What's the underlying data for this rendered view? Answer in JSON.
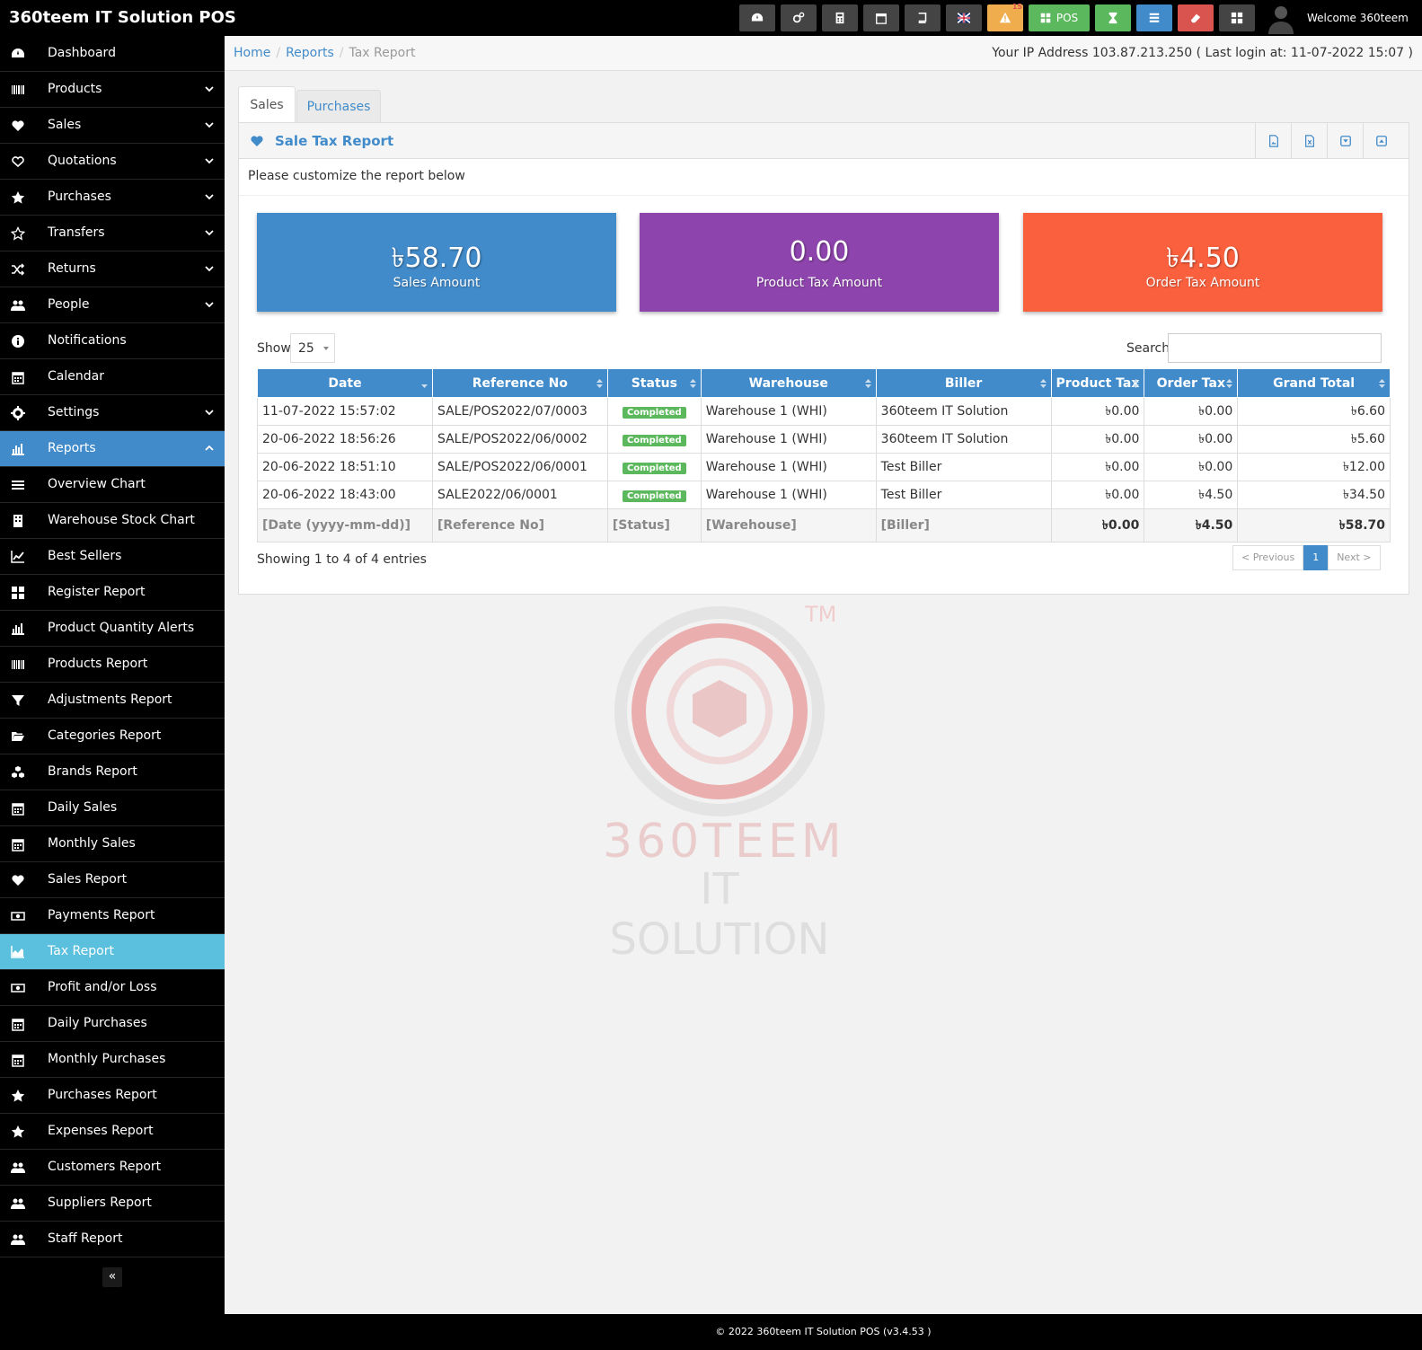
{
  "app": {
    "title": "360teem IT Solution POS",
    "welcome": "Welcome 360teem",
    "alert_count": "15",
    "pos_label": "POS"
  },
  "breadcrumb": {
    "home": "Home",
    "reports": "Reports",
    "current": "Tax Report"
  },
  "ip_info": "Your IP Address 103.87.213.250 ( Last login at: 11-07-2022 15:07 )",
  "sidebar": {
    "items": [
      {
        "label": "Dashboard",
        "icon": "dashboard-icon"
      },
      {
        "label": "Products",
        "icon": "barcode-icon"
      },
      {
        "label": "Sales",
        "icon": "heart-icon"
      },
      {
        "label": "Quotations",
        "icon": "heart-outline-icon"
      },
      {
        "label": "Purchases",
        "icon": "star-icon"
      },
      {
        "label": "Transfers",
        "icon": "star-outline-icon"
      },
      {
        "label": "Returns",
        "icon": "random-icon"
      },
      {
        "label": "People",
        "icon": "users-icon"
      },
      {
        "label": "Notifications",
        "icon": "info-icon"
      },
      {
        "label": "Calendar",
        "icon": "calendar-icon"
      },
      {
        "label": "Settings",
        "icon": "cog-icon"
      },
      {
        "label": "Reports",
        "icon": "bar-chart-icon"
      }
    ],
    "report_items": [
      {
        "label": "Overview Chart",
        "icon": "bars-icon"
      },
      {
        "label": "Warehouse Stock Chart",
        "icon": "building-icon"
      },
      {
        "label": "Best Sellers",
        "icon": "line-chart-icon"
      },
      {
        "label": "Register Report",
        "icon": "th-large-icon"
      },
      {
        "label": "Product Quantity Alerts",
        "icon": "bar-chart-icon"
      },
      {
        "label": "Products Report",
        "icon": "barcode-icon"
      },
      {
        "label": "Adjustments Report",
        "icon": "filter-icon"
      },
      {
        "label": "Categories Report",
        "icon": "folder-open-icon"
      },
      {
        "label": "Brands Report",
        "icon": "cubes-icon"
      },
      {
        "label": "Daily Sales",
        "icon": "calendar-icon"
      },
      {
        "label": "Monthly Sales",
        "icon": "calendar-icon"
      },
      {
        "label": "Sales Report",
        "icon": "heart-icon"
      },
      {
        "label": "Payments Report",
        "icon": "money-icon"
      },
      {
        "label": "Tax Report",
        "icon": "area-chart-icon"
      },
      {
        "label": "Profit and/or Loss",
        "icon": "money-icon"
      },
      {
        "label": "Daily Purchases",
        "icon": "calendar-icon"
      },
      {
        "label": "Monthly Purchases",
        "icon": "calendar-icon"
      },
      {
        "label": "Purchases Report",
        "icon": "star-icon"
      },
      {
        "label": "Expenses Report",
        "icon": "star-icon"
      },
      {
        "label": "Customers Report",
        "icon": "users-icon"
      },
      {
        "label": "Suppliers Report",
        "icon": "users-icon"
      },
      {
        "label": "Staff Report",
        "icon": "users-icon"
      }
    ],
    "collapse": "«"
  },
  "tabs": {
    "sales": "Sales",
    "purchases": "Purchases"
  },
  "panel": {
    "title": "Sale Tax Report",
    "intro": "Please customize the report below"
  },
  "stats": [
    {
      "value": "৳58.70",
      "caption": "Sales Amount",
      "color": "#428bca"
    },
    {
      "value": "0.00",
      "caption": "Product Tax Amount",
      "color": "#8e44ad"
    },
    {
      "value": "৳4.50",
      "caption": "Order Tax Amount",
      "color": "#fa603d"
    }
  ],
  "table": {
    "show_label": "Show",
    "show_value": "25",
    "search_label": "Search",
    "columns": [
      "Date",
      "Reference No",
      "Status",
      "Warehouse",
      "Biller",
      "Product Tax",
      "Order Tax",
      "Grand Total"
    ],
    "rows": [
      {
        "date": "11-07-2022 15:57:02",
        "ref": "SALE/POS2022/07/0003",
        "status": "Completed",
        "warehouse": "Warehouse 1 (WHI)",
        "biller": "360teem IT Solution",
        "ptax": "৳0.00",
        "otax": "৳0.00",
        "total": "৳6.60"
      },
      {
        "date": "20-06-2022 18:56:26",
        "ref": "SALE/POS2022/06/0002",
        "status": "Completed",
        "warehouse": "Warehouse 1 (WHI)",
        "biller": "360teem IT Solution",
        "ptax": "৳0.00",
        "otax": "৳0.00",
        "total": "৳5.60"
      },
      {
        "date": "20-06-2022 18:51:10",
        "ref": "SALE/POS2022/06/0001",
        "status": "Completed",
        "warehouse": "Warehouse 1 (WHI)",
        "biller": "Test Biller",
        "ptax": "৳0.00",
        "otax": "৳0.00",
        "total": "৳12.00"
      },
      {
        "date": "20-06-2022 18:43:00",
        "ref": "SALE2022/06/0001",
        "status": "Completed",
        "warehouse": "Warehouse 1 (WHI)",
        "biller": "Test Biller",
        "ptax": "৳0.00",
        "otax": "৳4.50",
        "total": "৳34.50"
      }
    ],
    "footer": {
      "date": "[Date (yyyy-mm-dd)]",
      "ref": "[Reference No]",
      "status": "[Status]",
      "warehouse": "[Warehouse]",
      "biller": "[Biller]",
      "ptax": "৳0.00",
      "otax": "৳4.50",
      "total": "৳58.70"
    },
    "info": "Showing 1 to 4 of 4 entries",
    "prev": "< Previous",
    "page": "1",
    "next": "Next >"
  },
  "watermark": {
    "line1": "360TEEM",
    "line2": "IT SOLUTION",
    "tm": "TM"
  },
  "footer": {
    "text": "© 2022 360teem IT Solution POS (v3.4.53 )"
  }
}
